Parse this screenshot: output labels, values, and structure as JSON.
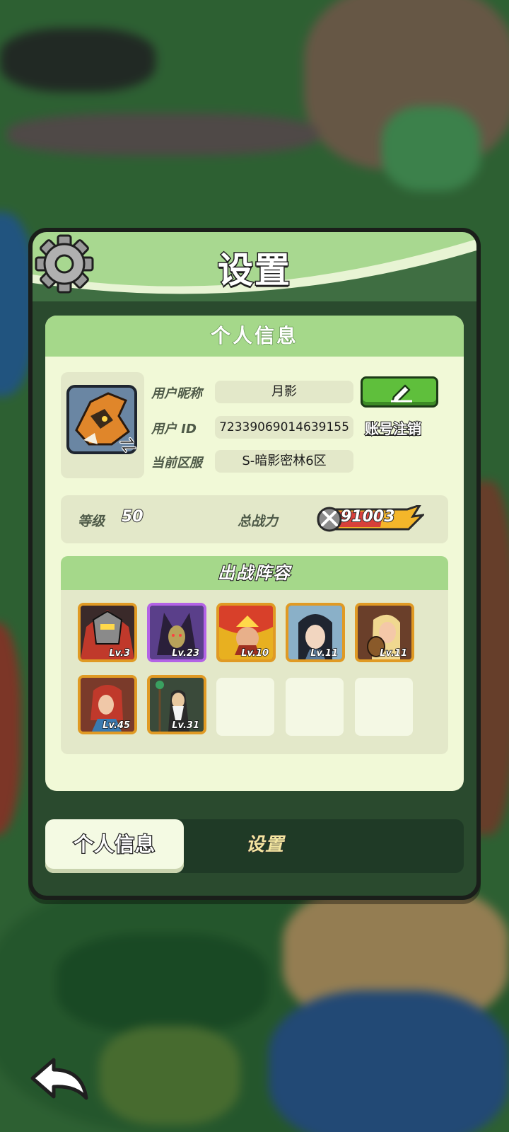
{
  "header": {
    "title": "设置",
    "icon": "gear-icon"
  },
  "profile": {
    "section_title": "个人信息",
    "nickname_label": "用户昵称",
    "nickname_value": "月影",
    "id_label": "用户  ID",
    "id_value": "72339069014639155",
    "server_label": "当前区服",
    "server_value": "S-暗影密林6区",
    "cancel_account_label": "账号注销"
  },
  "stats": {
    "level_label": "等级",
    "level_value": "50",
    "power_label": "总战力",
    "power_value": "91003"
  },
  "lineup": {
    "title": "出战阵容",
    "heroes": [
      {
        "level": "Lv.3",
        "frame": "gold"
      },
      {
        "level": "Lv.23",
        "frame": "purple"
      },
      {
        "level": "Lv.10",
        "frame": "gold"
      },
      {
        "level": "Lv.11",
        "frame": "gold"
      },
      {
        "level": "Lv.11",
        "frame": "gold"
      },
      {
        "level": "Lv.45",
        "frame": "gold"
      },
      {
        "level": "Lv.31",
        "frame": "gold"
      }
    ],
    "empty_slots": 3
  },
  "tabs": [
    {
      "label": "个人信息",
      "active": true
    },
    {
      "label": "设置",
      "active": false
    }
  ],
  "colors": {
    "panel_green": "#a5d88a",
    "card_bg": "#f1f9d7",
    "button_green": "#5fbf3c",
    "frame_gold": "#e09a24",
    "frame_purple": "#b363e6"
  }
}
